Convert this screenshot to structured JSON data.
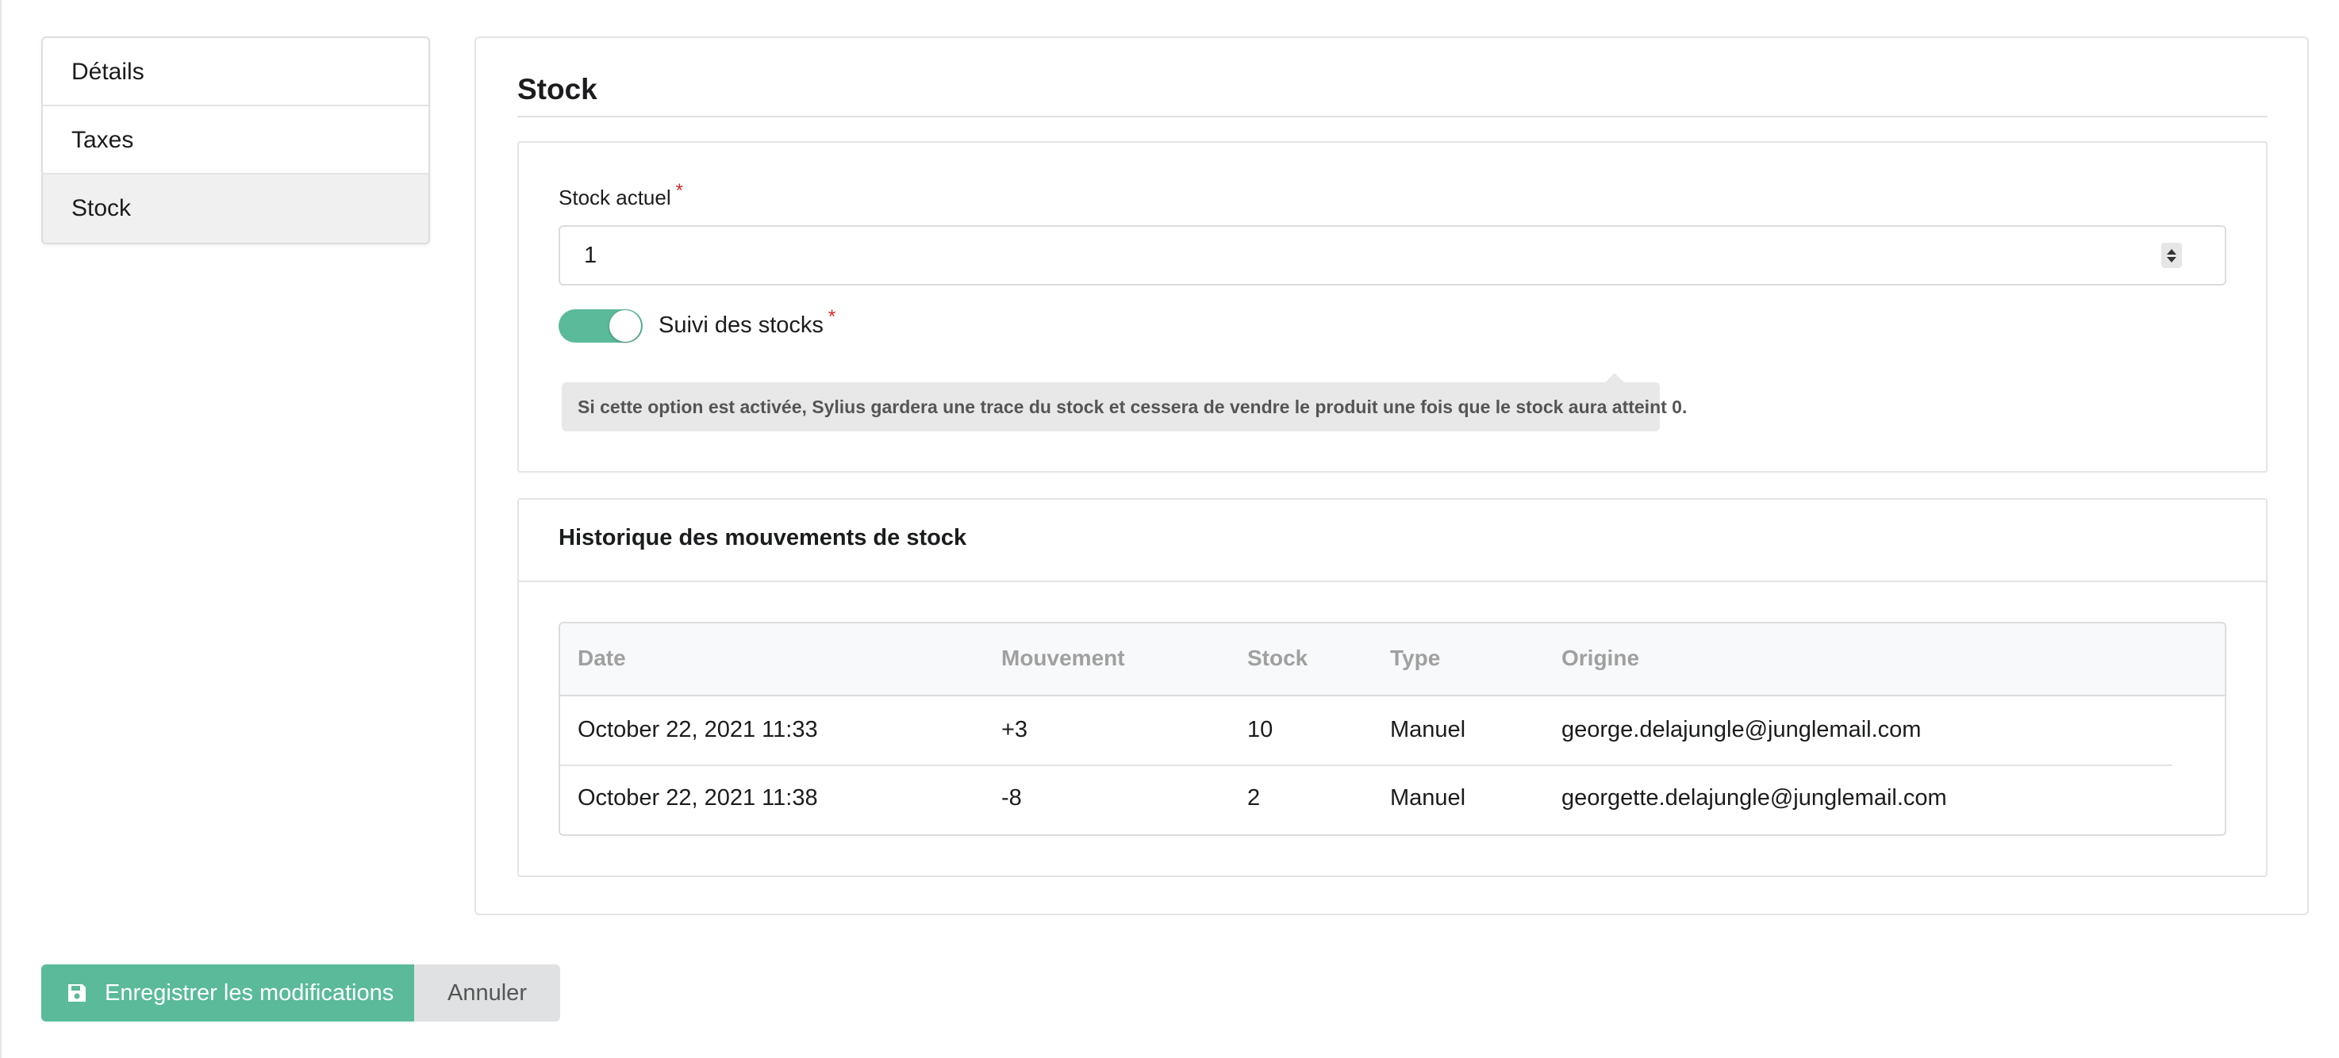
{
  "sidebar": {
    "items": [
      {
        "label": "Détails"
      },
      {
        "label": "Taxes"
      },
      {
        "label": "Stock"
      }
    ],
    "active": "Stock"
  },
  "panel": {
    "title": "Stock",
    "stock_field": {
      "label": "Stock actuel",
      "required_mark": "*",
      "value": "1"
    },
    "tracking": {
      "label": "Suivi des stocks",
      "required_mark": "*",
      "enabled": true,
      "help": "Si cette option est activée, Sylius gardera une trace du stock et cessera de vendre le produit une fois que le stock aura atteint 0."
    },
    "history": {
      "title": "Historique des mouvements de stock",
      "columns": [
        "Date",
        "Mouvement",
        "Stock",
        "Type",
        "Origine"
      ],
      "rows": [
        [
          "October 22, 2021 11:33",
          "+3",
          "10",
          "Manuel",
          "george.delajungle@junglemail.com"
        ],
        [
          "October 22, 2021 11:38",
          "-8",
          "2",
          "Manuel",
          "georgette.delajungle@junglemail.com"
        ]
      ]
    }
  },
  "footer": {
    "save_label": "Enregistrer les modifications",
    "cancel_label": "Annuler"
  },
  "colors": {
    "accent": "#5aba9a",
    "required": "#db2828"
  },
  "icons": {
    "save": "floppy-disk-icon"
  }
}
